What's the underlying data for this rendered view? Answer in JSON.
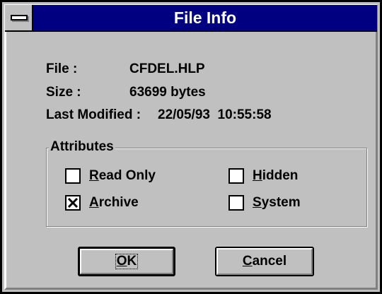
{
  "window": {
    "title": "File Info"
  },
  "info": {
    "file_label": "File :",
    "file_value": "CFDEL.HLP",
    "size_label": "Size :",
    "size_value": "63699 bytes",
    "modified_label": "Last Modified :",
    "modified_value": "22/05/93  10:55:58"
  },
  "attributes": {
    "legend": "Attributes",
    "read_only": {
      "label_hotkey": "R",
      "label_rest": "ead Only",
      "checked": false
    },
    "hidden": {
      "label_hotkey": "H",
      "label_rest": "idden",
      "checked": false
    },
    "archive": {
      "label_hotkey": "A",
      "label_rest": "rchive",
      "checked": true
    },
    "system": {
      "label_hotkey": "S",
      "label_rest": "ystem",
      "checked": false
    }
  },
  "buttons": {
    "ok_hotkey": "O",
    "ok_rest": "K",
    "cancel_hotkey": "C",
    "cancel_rest": "ancel"
  },
  "colors": {
    "titlebar": "#000080",
    "face": "#c0c0c0",
    "highlight": "#ffffff",
    "shadow": "#808080"
  }
}
